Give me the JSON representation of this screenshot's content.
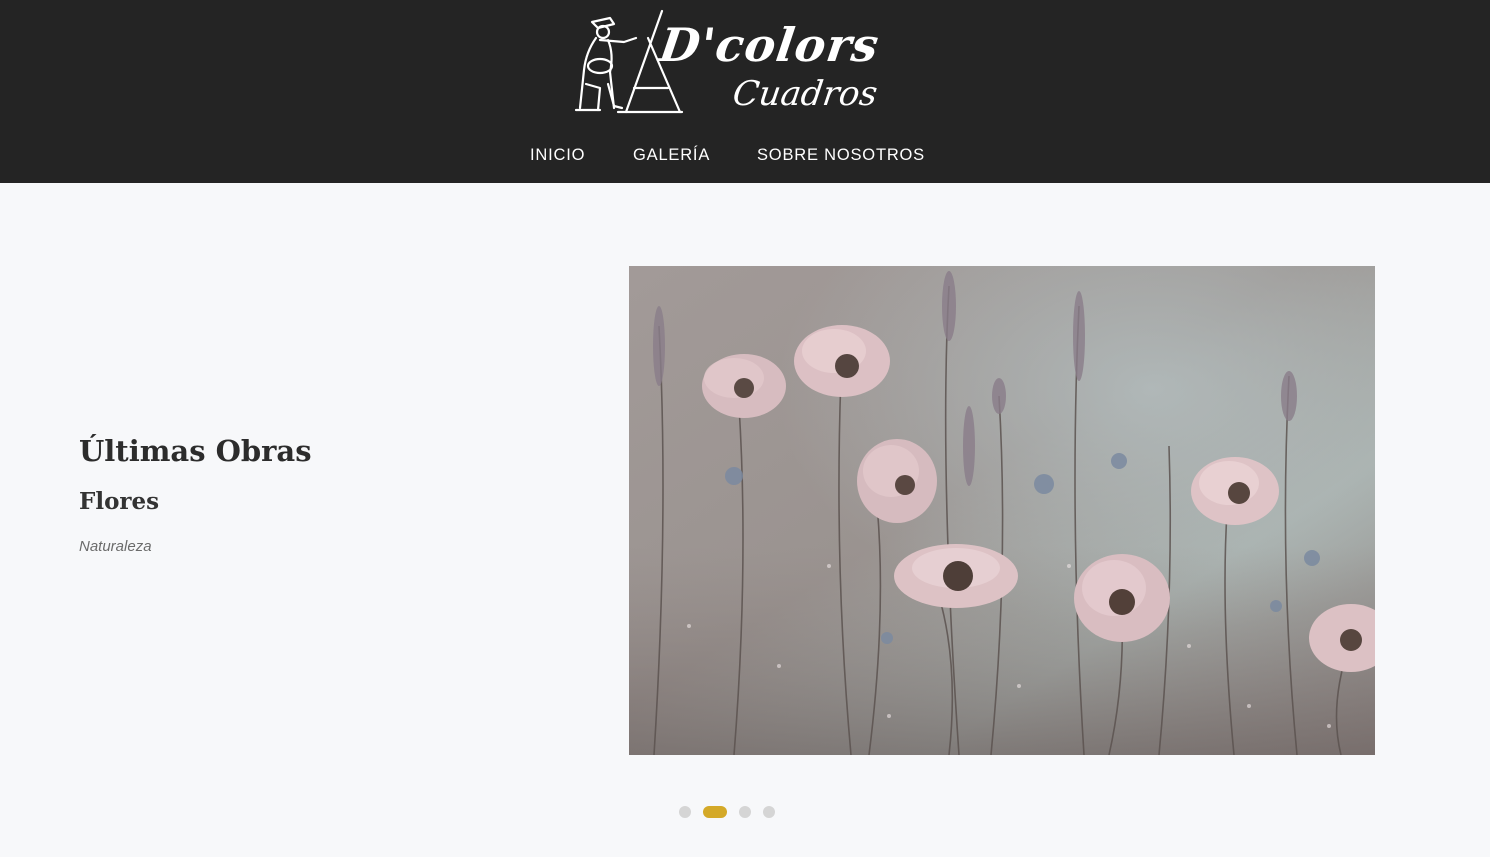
{
  "header": {
    "logo": {
      "brand": "D'colors",
      "subtitle": "Cuadros"
    },
    "nav": [
      {
        "label": "INICIO"
      },
      {
        "label": "GALERÍA"
      },
      {
        "label": "SOBRE NOSOTROS"
      }
    ]
  },
  "featured": {
    "heading": "Últimas Obras",
    "title": "Flores",
    "category": "Naturaleza"
  },
  "slider": {
    "slide_count": 4,
    "active_index": 2
  },
  "colors": {
    "header_bg": "#242424",
    "page_bg": "#f7f8fa",
    "accent": "#d4a928",
    "dot_inactive": "#d5d5d5"
  }
}
